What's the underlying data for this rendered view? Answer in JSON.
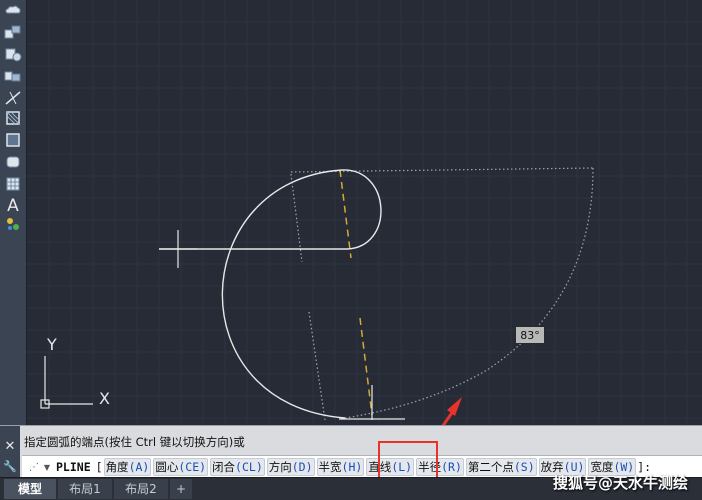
{
  "toolbar": {
    "tools": [
      {
        "name": "cloud-icon"
      },
      {
        "name": "block-insert-icon"
      },
      {
        "name": "block-make-icon"
      },
      {
        "name": "line-erase-icon"
      },
      {
        "name": "hatch-icon"
      },
      {
        "name": "gradient-icon"
      },
      {
        "name": "region-icon"
      },
      {
        "name": "table-icon"
      },
      {
        "name": "multiline-text-icon",
        "glyph": "A"
      },
      {
        "name": "add-selected-icon"
      }
    ]
  },
  "canvas": {
    "angle_tooltip": "83°",
    "ucs": {
      "y_label": "Y",
      "x_label": "X"
    },
    "colors": {
      "background": "#262b35",
      "polyline": "#e8e8e8",
      "dashed_guide": "#d4a93a",
      "dotted_guide": "#9aa0a8"
    }
  },
  "command_line": {
    "close_glyph": "✕",
    "settings_glyph": "🔧",
    "history": "指定圆弧的端点(按住 Ctrl 键以切换方向)或",
    "command": "PLINE",
    "open_bracket": "[",
    "options": [
      {
        "label": "角度",
        "key": "(A)"
      },
      {
        "label": "圆心",
        "key": "(CE)"
      },
      {
        "label": "闭合",
        "key": "(CL)"
      },
      {
        "label": "方向",
        "key": "(D)"
      },
      {
        "label": "半宽",
        "key": "(H)"
      },
      {
        "label": "直线",
        "key": "(L)"
      },
      {
        "label": "半径",
        "key": "(R)"
      },
      {
        "label": "第二个点",
        "key": "(S)"
      },
      {
        "label": "放弃",
        "key": "(U)"
      },
      {
        "label": "宽度",
        "key": "(W)"
      }
    ],
    "close_bracket": "]:",
    "highlight_color": "#e8332a"
  },
  "tabs": [
    {
      "label": "模型",
      "active": true
    },
    {
      "label": "布局1",
      "active": false
    },
    {
      "label": "布局2",
      "active": false
    },
    {
      "label": "+",
      "active": false
    }
  ],
  "watermark": "搜狐号@天水牛测绘"
}
